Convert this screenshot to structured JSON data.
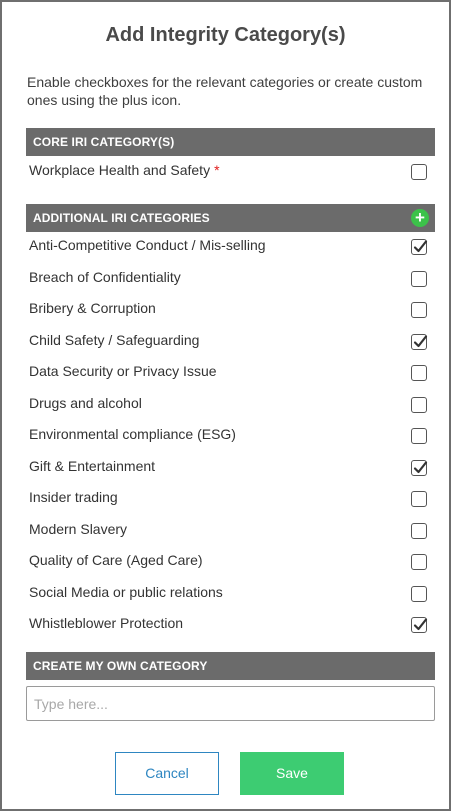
{
  "dialog": {
    "title": "Add Integrity Category(s)",
    "description": "Enable checkboxes for the relevant categories or create custom ones using the plus icon."
  },
  "core": {
    "header": "CORE IRI CATEGORY(S)",
    "items": [
      {
        "label": "Workplace Health and Safety",
        "required": "*",
        "checked": false
      }
    ]
  },
  "additional": {
    "header": "ADDITIONAL IRI CATEGORIES",
    "add_icon": "plus-circle-icon",
    "items": [
      {
        "label": "Anti-Competitive Conduct / Mis-selling",
        "checked": true
      },
      {
        "label": "Breach of Confidentiality",
        "checked": false
      },
      {
        "label": "Bribery & Corruption",
        "checked": false
      },
      {
        "label": "Child Safety / Safeguarding",
        "checked": true
      },
      {
        "label": "Data Security or Privacy Issue",
        "checked": false
      },
      {
        "label": "Drugs and alcohol",
        "checked": false
      },
      {
        "label": "Environmental compliance (ESG)",
        "checked": false
      },
      {
        "label": "Gift & Entertainment",
        "checked": true
      },
      {
        "label": "Insider trading",
        "checked": false
      },
      {
        "label": "Modern Slavery",
        "checked": false
      },
      {
        "label": "Quality of Care (Aged Care)",
        "checked": false
      },
      {
        "label": "Social Media or public relations",
        "checked": false
      },
      {
        "label": "Whistleblower Protection",
        "checked": true
      }
    ]
  },
  "custom": {
    "header": "CREATE MY OWN CATEGORY",
    "input_value": "",
    "input_placeholder": "Type here..."
  },
  "buttons": {
    "cancel": "Cancel",
    "save": "Save"
  },
  "colors": {
    "section_bg": "#6b6b6b",
    "accent_green": "#3dcc72",
    "cancel_blue": "#2e86c1",
    "required_red": "#e01b1b"
  }
}
